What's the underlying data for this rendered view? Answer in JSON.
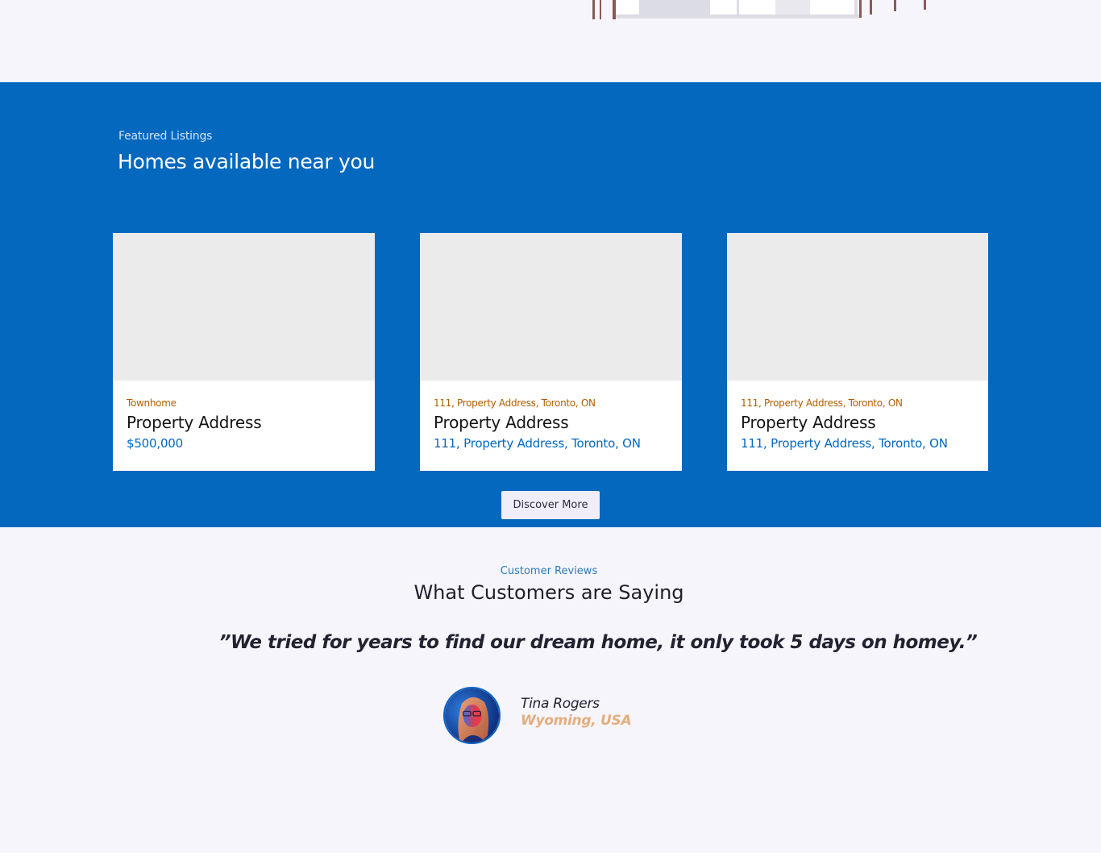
{
  "featured": {
    "eyebrow": "Featured Listings",
    "title": "Homes available near you",
    "cards": [
      {
        "tag": "Townhome",
        "title": "Property Address",
        "subtitle": "$500,000"
      },
      {
        "tag": "111, Property Address, Toronto, ON",
        "title": "Property Address",
        "subtitle": "111, Property Address, Toronto, ON"
      },
      {
        "tag": "111, Property Address, Toronto, ON",
        "title": "Property Address",
        "subtitle": "111, Property Address, Toronto, ON"
      }
    ],
    "discover_label": "Discover More"
  },
  "reviews": {
    "eyebrow": "Customer Reviews",
    "title": "What Customers are Saying",
    "quote": "”We tried for years to find our dream home, it only took 5 days on homey.”",
    "reviewer": {
      "name": "Tina Rogers",
      "location": "Wyoming, USA"
    }
  },
  "colors": {
    "brand_blue": "#0468bf",
    "accent_orange": "#b05e00",
    "location_tan": "#e4ad7e"
  }
}
